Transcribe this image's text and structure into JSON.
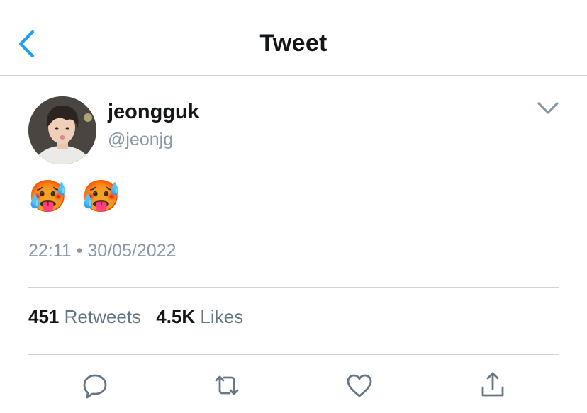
{
  "header": {
    "title": "Tweet"
  },
  "tweet": {
    "author_name": "jeongguk",
    "author_handle": "@jeonjg",
    "text": "🥵 🥵",
    "time": "22:11",
    "separator": "•",
    "date": "30/05/2022",
    "retweets_count": "451",
    "retweets_label": "Retweets",
    "likes_count": "4.5K",
    "likes_label": "Likes"
  },
  "colors": {
    "accent": "#1da1f2",
    "secondary_text": "#8899a6",
    "divider": "#cfd3d6",
    "icon": "#657786"
  },
  "icons": [
    "chevron-left-icon",
    "chevron-down-icon",
    "reply-icon",
    "retweet-icon",
    "heart-icon",
    "share-icon"
  ]
}
